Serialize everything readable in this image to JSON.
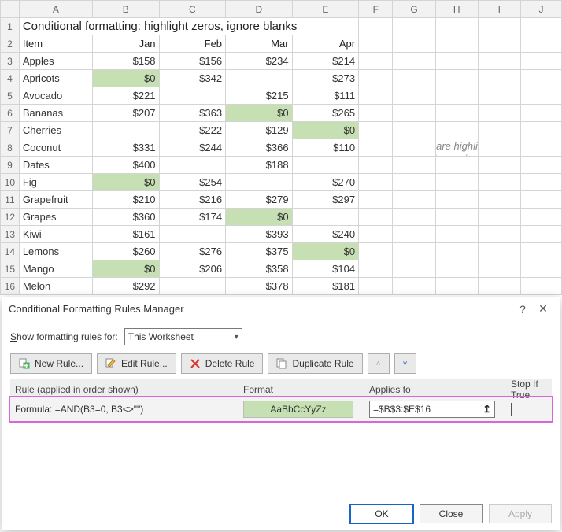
{
  "columns": [
    "A",
    "B",
    "C",
    "D",
    "E",
    "F",
    "G",
    "H",
    "I",
    "J"
  ],
  "title": "Conditional formatting: highlight zeros, ignore blanks",
  "headers": {
    "item": "Item",
    "months": [
      "Jan",
      "Feb",
      "Mar",
      "Apr"
    ]
  },
  "note": "Zeros are highlighted,\nblanks are ignored",
  "rows": [
    {
      "n": 3,
      "item": "Apples",
      "v": [
        "$158",
        "$156",
        "$234",
        "$214"
      ]
    },
    {
      "n": 4,
      "item": "Apricots",
      "v": [
        "$0",
        "$342",
        "",
        "$273"
      ]
    },
    {
      "n": 5,
      "item": "Avocado",
      "v": [
        "$221",
        "",
        "$215",
        "$111"
      ]
    },
    {
      "n": 6,
      "item": "Bananas",
      "v": [
        "$207",
        "$363",
        "$0",
        "$265"
      ]
    },
    {
      "n": 7,
      "item": "Cherries",
      "v": [
        "",
        "$222",
        "$129",
        "$0"
      ]
    },
    {
      "n": 8,
      "item": "Coconut",
      "v": [
        "$331",
        "$244",
        "$366",
        "$110"
      ]
    },
    {
      "n": 9,
      "item": "Dates",
      "v": [
        "$400",
        "",
        "$188",
        ""
      ]
    },
    {
      "n": 10,
      "item": "Fig",
      "v": [
        "$0",
        "$254",
        "",
        "$270"
      ]
    },
    {
      "n": 11,
      "item": "Grapefruit",
      "v": [
        "$210",
        "$216",
        "$279",
        "$297"
      ]
    },
    {
      "n": 12,
      "item": "Grapes",
      "v": [
        "$360",
        "$174",
        "$0",
        ""
      ]
    },
    {
      "n": 13,
      "item": "Kiwi",
      "v": [
        "$161",
        "",
        "$393",
        "$240"
      ]
    },
    {
      "n": 14,
      "item": "Lemons",
      "v": [
        "$260",
        "$276",
        "$375",
        "$0"
      ]
    },
    {
      "n": 15,
      "item": "Mango",
      "v": [
        "$0",
        "$206",
        "$358",
        "$104"
      ]
    },
    {
      "n": 16,
      "item": "Melon",
      "v": [
        "$292",
        "",
        "$378",
        "$181"
      ]
    }
  ],
  "dialog": {
    "title": "Conditional Formatting Rules Manager",
    "showFor": {
      "label": "Show formatting rules for:",
      "value": "This Worksheet"
    },
    "buttons": {
      "new": "New Rule...",
      "edit": "Edit Rule...",
      "delete": "Delete Rule",
      "duplicate": "Duplicate Rule"
    },
    "headers": {
      "rule": "Rule (applied in order shown)",
      "format": "Format",
      "applies": "Applies to",
      "stop": "Stop If True"
    },
    "rule": {
      "formula_label": "Formula:",
      "formula": "=AND(B3=0, B3<>\"\")",
      "preview": "AaBbCcYyZz",
      "applies": "=$B$3:$E$16"
    },
    "footer": {
      "ok": "OK",
      "close": "Close",
      "apply": "Apply"
    }
  },
  "chart_data": {
    "type": "table",
    "title": "Conditional formatting: highlight zeros, ignore blanks",
    "columns": [
      "Item",
      "Jan",
      "Feb",
      "Mar",
      "Apr"
    ],
    "rows": [
      [
        "Apples",
        158,
        156,
        234,
        214
      ],
      [
        "Apricots",
        0,
        342,
        null,
        273
      ],
      [
        "Avocado",
        221,
        null,
        215,
        111
      ],
      [
        "Bananas",
        207,
        363,
        0,
        265
      ],
      [
        "Cherries",
        null,
        222,
        129,
        0
      ],
      [
        "Coconut",
        331,
        244,
        366,
        110
      ],
      [
        "Dates",
        400,
        null,
        188,
        null
      ],
      [
        "Fig",
        0,
        254,
        null,
        270
      ],
      [
        "Grapefruit",
        210,
        216,
        279,
        297
      ],
      [
        "Grapes",
        360,
        174,
        0,
        null
      ],
      [
        "Kiwi",
        161,
        null,
        393,
        240
      ],
      [
        "Lemons",
        260,
        276,
        375,
        0
      ],
      [
        "Mango",
        0,
        206,
        358,
        104
      ],
      [
        "Melon",
        292,
        null,
        378,
        181
      ]
    ],
    "highlight_rule": "cell==0 AND cell not blank",
    "highlight_color": "#c6e0b4"
  }
}
